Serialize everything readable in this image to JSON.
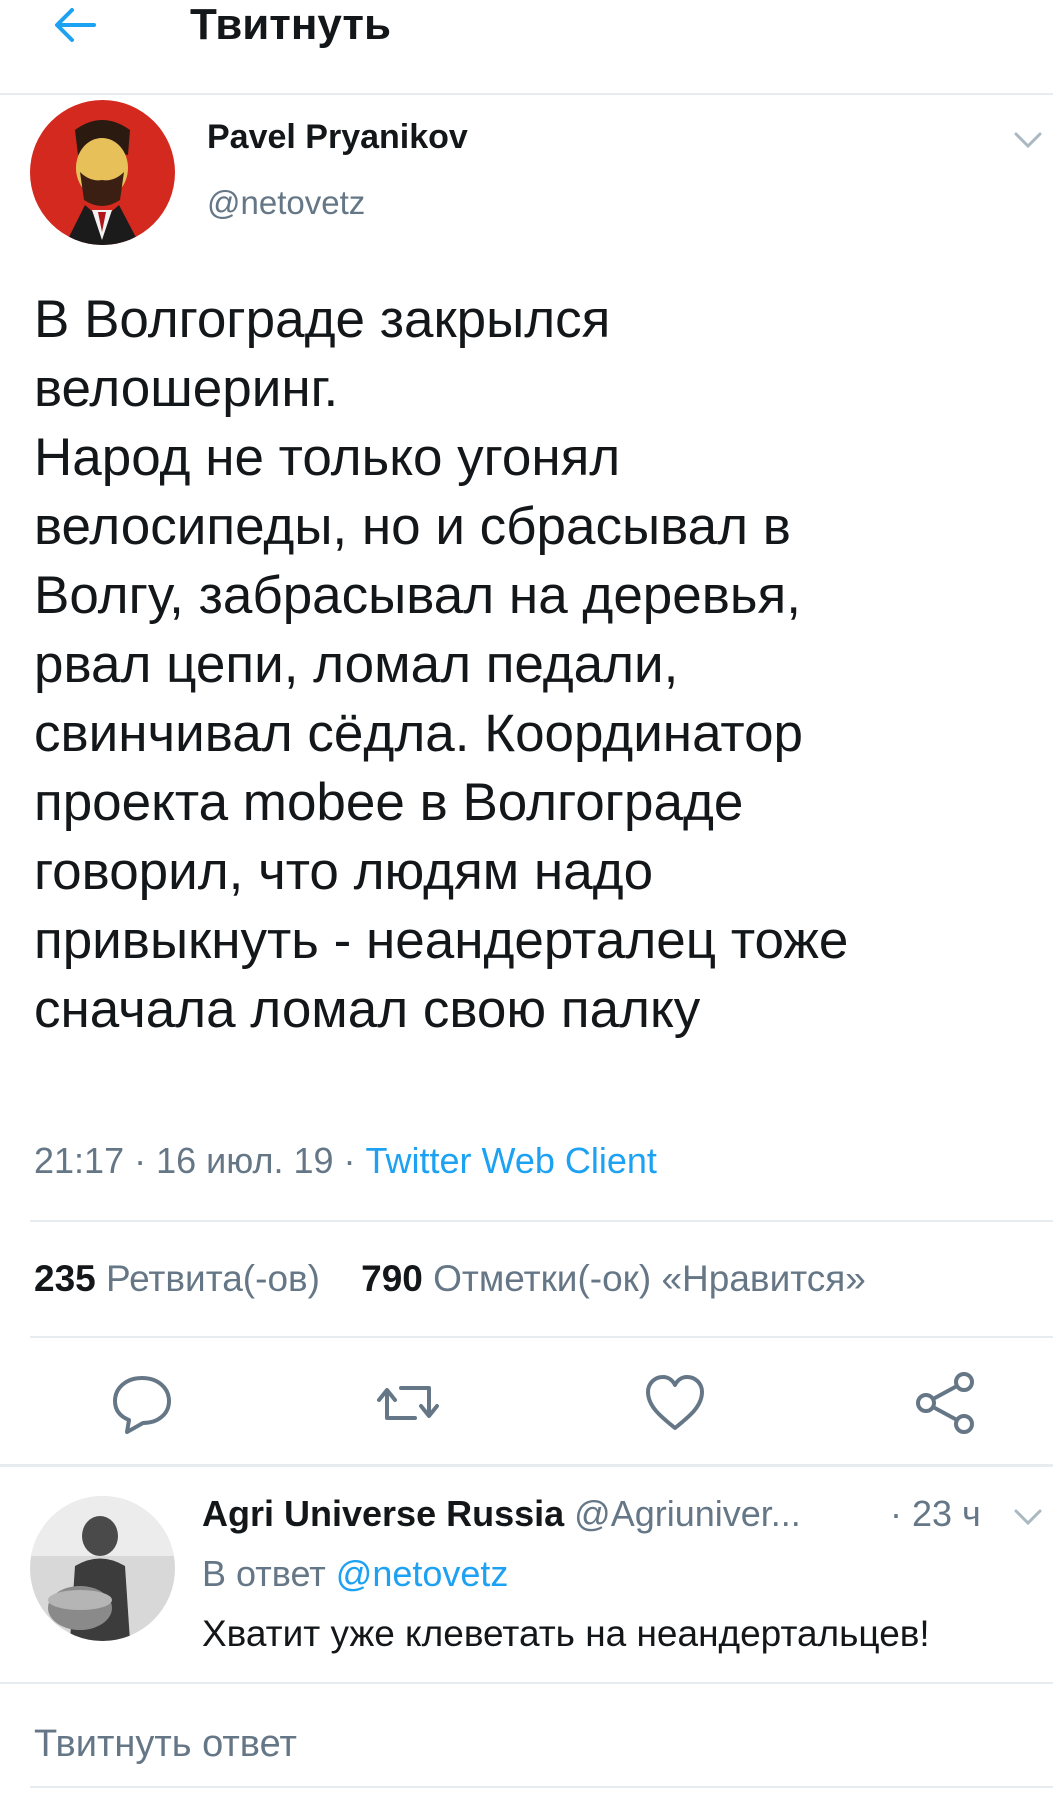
{
  "header": {
    "back_icon": "arrow-left-icon",
    "title": "Твитнуть"
  },
  "tweet": {
    "author_name": "Pavel Pryanikov",
    "author_handle": "@netovetz",
    "text_lines": [
      "В Волгограде закрылся",
      "велошеринг.",
      "Народ не только угонял",
      "велосипеды, но и сбрасывал в",
      "Волгу, забрасывал на деревья,",
      "рвал цепи, ломал педали,",
      "свинчивал сёдла. Координатор",
      "проекта mobee в Волгограде",
      "говорил, что людям надо",
      "привыкнуть - неандерталец тоже",
      "сначала ломал свою палку"
    ],
    "time": "21:17 · 16 июл. 19 · ",
    "source": "Twitter Web Client",
    "retweets_count": "235",
    "retweets_label": "Ретвита(-ов)",
    "likes_count": "790",
    "likes_label": "Отметки(-ок) «Нравится»",
    "actions": [
      "reply-icon",
      "retweet-icon",
      "like-icon",
      "share-icon"
    ]
  },
  "reply": {
    "author_name": "Agri Universe Russia",
    "author_handle": "@Agriuniver...",
    "time": "· 23 ч",
    "reply_to_label": "В ответ",
    "reply_to_handle": "@netovetz",
    "text": "Хватит уже клеветать на неандертальцев!"
  },
  "compose": {
    "placeholder": "Твитнуть ответ"
  },
  "colors": {
    "accent": "#1da1f2",
    "secondary_text": "#657786",
    "divider": "#e6ecf0"
  }
}
